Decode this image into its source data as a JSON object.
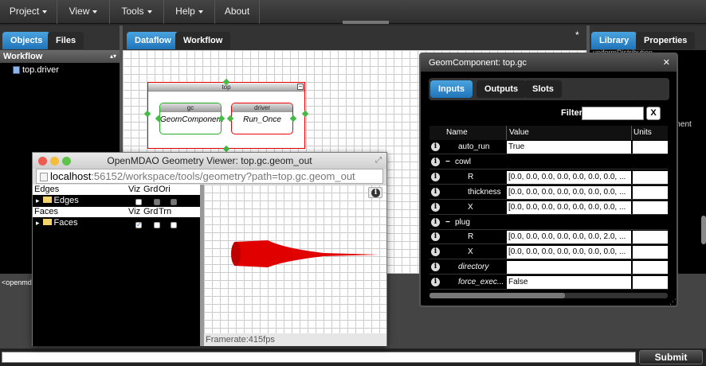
{
  "menubar": {
    "items": [
      {
        "label": "Project"
      },
      {
        "label": "View"
      },
      {
        "label": "Tools"
      },
      {
        "label": "Help"
      },
      {
        "label": "About"
      }
    ]
  },
  "left_panel": {
    "tabs": [
      {
        "label": "Objects"
      },
      {
        "label": "Files"
      }
    ],
    "section": "Workflow",
    "tree_item": "top.driver",
    "console_text": "<openmd"
  },
  "center_panel": {
    "tabs": [
      {
        "label": "Dataflow"
      },
      {
        "label": "Workflow"
      }
    ],
    "modified_marker": "*",
    "assembly": {
      "title": "top",
      "components": [
        {
          "type": "gc",
          "name": "GeomComponent"
        },
        {
          "type": "driver",
          "name": "Run_Once"
        }
      ]
    }
  },
  "right_panel": {
    "tabs": [
      {
        "label": "Library"
      },
      {
        "label": "Properties"
      }
    ],
    "fragment_top": "uniformDistribution",
    "fragment_side": "ement"
  },
  "geom_viewer": {
    "title": "OpenMDAO Geometry Viewer: top.gc.geom_out",
    "url_host": "localhost",
    "url_rest": ":56152/workspace/tools/geometry?path=top.gc.geom_out",
    "edges_header": {
      "label": "Edges",
      "cols": [
        "Viz",
        "Grd",
        "Ori"
      ]
    },
    "edges_item": "Edges",
    "faces_header": {
      "label": "Faces",
      "cols": [
        "Viz",
        "Grd",
        "Trn"
      ]
    },
    "faces_item": "Faces",
    "framerate": "Framerate:415fps",
    "shape_color": "#e00000"
  },
  "prop_window": {
    "title": "GeomComponent: top.gc",
    "tabs": [
      {
        "label": "Inputs"
      },
      {
        "label": "Outputs"
      },
      {
        "label": "Slots"
      }
    ],
    "filter_label": "Filter",
    "filter_value": "",
    "clear_label": "X",
    "columns": [
      "Name",
      "Value",
      "Units"
    ],
    "rows": [
      {
        "name": "auto_run",
        "value": "True",
        "indent": 1,
        "italic": false,
        "expand": ""
      },
      {
        "name": "cowl",
        "value": "",
        "indent": 1,
        "italic": false,
        "expand": "−"
      },
      {
        "name": "R",
        "value": "[0.0, 0.0, 0.0, 0.0, 0.0, 0.0, 0.0, ...",
        "indent": 2,
        "italic": false,
        "expand": ""
      },
      {
        "name": "thickness",
        "value": "[0.0, 0.0, 0.0, 0.0, 0.0, 0.0, 0.0, ...",
        "indent": 2,
        "italic": false,
        "expand": ""
      },
      {
        "name": "X",
        "value": "[0.0, 0.0, 0.0, 0.0, 0.0, 0.0, 0.0, ...",
        "indent": 2,
        "italic": false,
        "expand": ""
      },
      {
        "name": "plug",
        "value": "",
        "indent": 1,
        "italic": false,
        "expand": "−"
      },
      {
        "name": "R",
        "value": "[0.0, 0.0, 0.0, 0.0, 0.0, 0.0, 2.0, ...",
        "indent": 2,
        "italic": false,
        "expand": ""
      },
      {
        "name": "X",
        "value": "[0.0, 0.0, 0.0, 0.0, 0.0, 0.0, 0.0, ...",
        "indent": 2,
        "italic": false,
        "expand": ""
      },
      {
        "name": "directory",
        "value": "",
        "indent": 1,
        "italic": true,
        "expand": ""
      },
      {
        "name": "force_exec...",
        "value": "False",
        "indent": 1,
        "italic": true,
        "expand": ""
      }
    ]
  },
  "bottom": {
    "command_value": "",
    "submit_label": "Submit"
  }
}
